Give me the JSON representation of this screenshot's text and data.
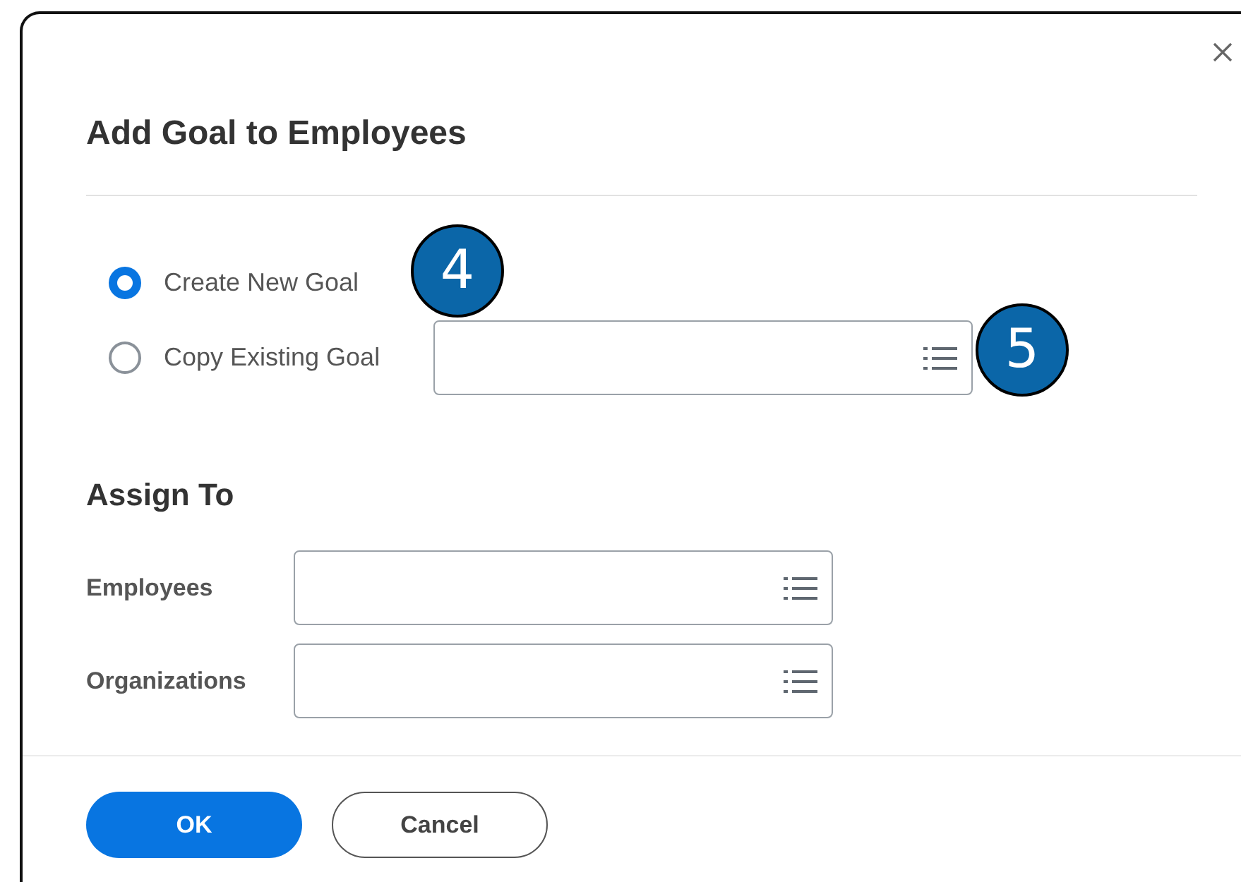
{
  "dialog": {
    "title": "Add Goal to Employees"
  },
  "goal_options": [
    {
      "label": "Create New Goal",
      "selected": true
    },
    {
      "label": "Copy Existing Goal",
      "selected": false
    }
  ],
  "callouts": [
    "4",
    "5"
  ],
  "assign_to": {
    "heading": "Assign To",
    "fields": [
      {
        "label": "Employees"
      },
      {
        "label": "Organizations"
      }
    ]
  },
  "buttons": [
    {
      "label": "OK",
      "kind": "primary"
    },
    {
      "label": "Cancel",
      "kind": "secondary"
    }
  ]
}
